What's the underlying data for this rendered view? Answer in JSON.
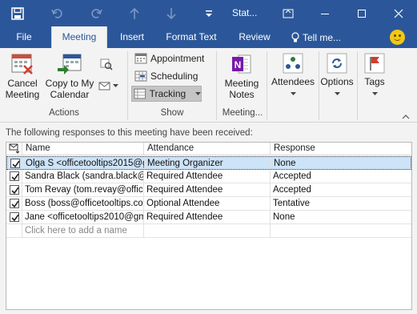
{
  "titlebar": {
    "title": "Stat...",
    "icons": [
      "save-icon",
      "undo-icon",
      "redo-icon",
      "up-arrow-icon",
      "down-arrow-icon",
      "customize-icon"
    ],
    "bg": "#2b579a"
  },
  "tabs": [
    {
      "label": "File"
    },
    {
      "label": "Meeting"
    },
    {
      "label": "Insert"
    },
    {
      "label": "Format Text"
    },
    {
      "label": "Review"
    }
  ],
  "tellme": "Tell me...",
  "ribbon": {
    "cancel_meeting": "Cancel\nMeeting",
    "copy_to_calendar": "Copy to My\nCalendar",
    "actions_label": "Actions",
    "appointment": "Appointment",
    "scheduling": "Scheduling",
    "tracking": "Tracking",
    "show_label": "Show",
    "meeting_notes": "Meeting\nNotes",
    "meeting_group_label": "Meeting...",
    "attendees": "Attendees",
    "options": "Options",
    "tags": "Tags"
  },
  "content": {
    "info": "The following responses to this meeting have been received:",
    "columns": [
      "Name",
      "Attendance",
      "Response"
    ],
    "rows": [
      {
        "name": "Olga S <officetooltips2015@gm",
        "attendance": "Meeting Organizer",
        "response": "None",
        "checked": true,
        "selected": true
      },
      {
        "name": "Sandra Black (sandra.black@offi",
        "attendance": "Required Attendee",
        "response": "Accepted",
        "checked": true,
        "selected": false
      },
      {
        "name": "Tom Revay (tom.revay@officet",
        "attendance": "Required Attendee",
        "response": "Accepted",
        "checked": true,
        "selected": false
      },
      {
        "name": "Boss (boss@officetooltips.com)",
        "attendance": "Optional Attendee",
        "response": "Tentative",
        "checked": true,
        "selected": false
      },
      {
        "name": "Jane <officetooltips2010@gma",
        "attendance": "Required Attendee",
        "response": "None",
        "checked": true,
        "selected": false
      }
    ],
    "add_placeholder": "Click here to add a name"
  }
}
